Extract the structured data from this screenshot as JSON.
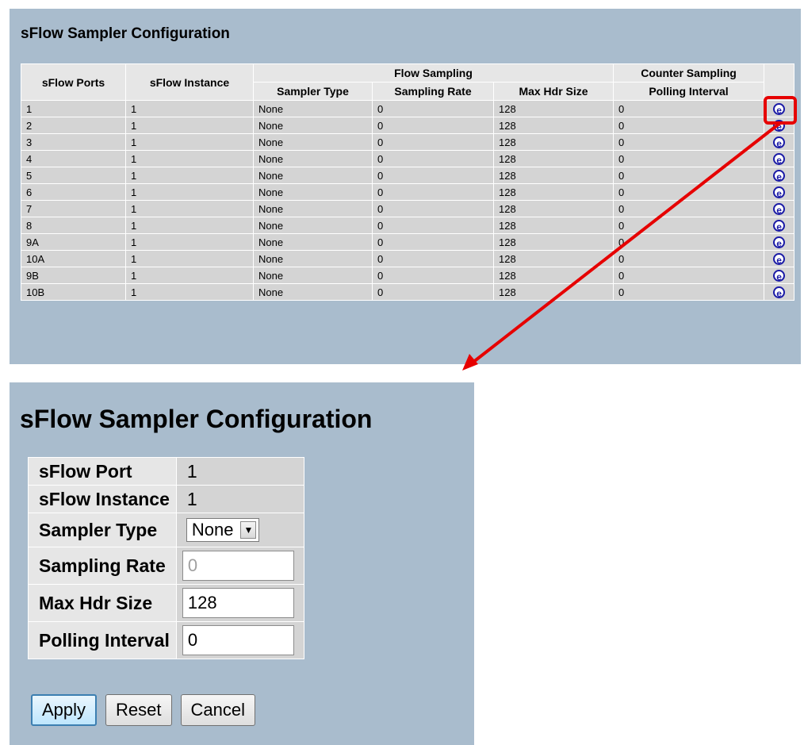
{
  "overview": {
    "title": "sFlow Sampler Configuration",
    "headers": {
      "ports": "sFlow Ports",
      "instance": "sFlow Instance",
      "flow_sampling": "Flow Sampling",
      "counter_sampling": "Counter Sampling",
      "sampler_type": "Sampler Type",
      "sampling_rate": "Sampling Rate",
      "max_hdr_size": "Max Hdr Size",
      "polling_interval": "Polling Interval"
    },
    "edit_icon_glyph": "e",
    "rows": [
      {
        "port": "1",
        "instance": "1",
        "sampler_type": "None",
        "sampling_rate": "0",
        "max_hdr_size": "128",
        "polling_interval": "0"
      },
      {
        "port": "2",
        "instance": "1",
        "sampler_type": "None",
        "sampling_rate": "0",
        "max_hdr_size": "128",
        "polling_interval": "0"
      },
      {
        "port": "3",
        "instance": "1",
        "sampler_type": "None",
        "sampling_rate": "0",
        "max_hdr_size": "128",
        "polling_interval": "0"
      },
      {
        "port": "4",
        "instance": "1",
        "sampler_type": "None",
        "sampling_rate": "0",
        "max_hdr_size": "128",
        "polling_interval": "0"
      },
      {
        "port": "5",
        "instance": "1",
        "sampler_type": "None",
        "sampling_rate": "0",
        "max_hdr_size": "128",
        "polling_interval": "0"
      },
      {
        "port": "6",
        "instance": "1",
        "sampler_type": "None",
        "sampling_rate": "0",
        "max_hdr_size": "128",
        "polling_interval": "0"
      },
      {
        "port": "7",
        "instance": "1",
        "sampler_type": "None",
        "sampling_rate": "0",
        "max_hdr_size": "128",
        "polling_interval": "0"
      },
      {
        "port": "8",
        "instance": "1",
        "sampler_type": "None",
        "sampling_rate": "0",
        "max_hdr_size": "128",
        "polling_interval": "0"
      },
      {
        "port": "9A",
        "instance": "1",
        "sampler_type": "None",
        "sampling_rate": "0",
        "max_hdr_size": "128",
        "polling_interval": "0"
      },
      {
        "port": "10A",
        "instance": "1",
        "sampler_type": "None",
        "sampling_rate": "0",
        "max_hdr_size": "128",
        "polling_interval": "0"
      },
      {
        "port": "9B",
        "instance": "1",
        "sampler_type": "None",
        "sampling_rate": "0",
        "max_hdr_size": "128",
        "polling_interval": "0"
      },
      {
        "port": "10B",
        "instance": "1",
        "sampler_type": "None",
        "sampling_rate": "0",
        "max_hdr_size": "128",
        "polling_interval": "0"
      }
    ]
  },
  "detail": {
    "title": "sFlow Sampler Configuration",
    "port_label": "sFlow Port",
    "port_value": "1",
    "instance_label": "sFlow Instance",
    "instance_value": "1",
    "sampler_type_label": "Sampler Type",
    "sampler_type_value": "None",
    "sampling_rate_label": "Sampling Rate",
    "sampling_rate_value": "0",
    "max_hdr_size_label": "Max Hdr Size",
    "max_hdr_size_value": "128",
    "polling_interval_label": "Polling Interval",
    "polling_interval_value": "0",
    "buttons": {
      "apply": "Apply",
      "reset": "Reset",
      "cancel": "Cancel"
    }
  },
  "colors": {
    "panel_bg": "#a9bccd",
    "header_bg": "#e6e6e6",
    "cell_bg": "#d4d4d4",
    "edit_icon": "#1a1aa6",
    "callout": "#e60000"
  },
  "icons": {
    "edit": "edit-icon",
    "dropdown": "chevron-down-icon"
  }
}
